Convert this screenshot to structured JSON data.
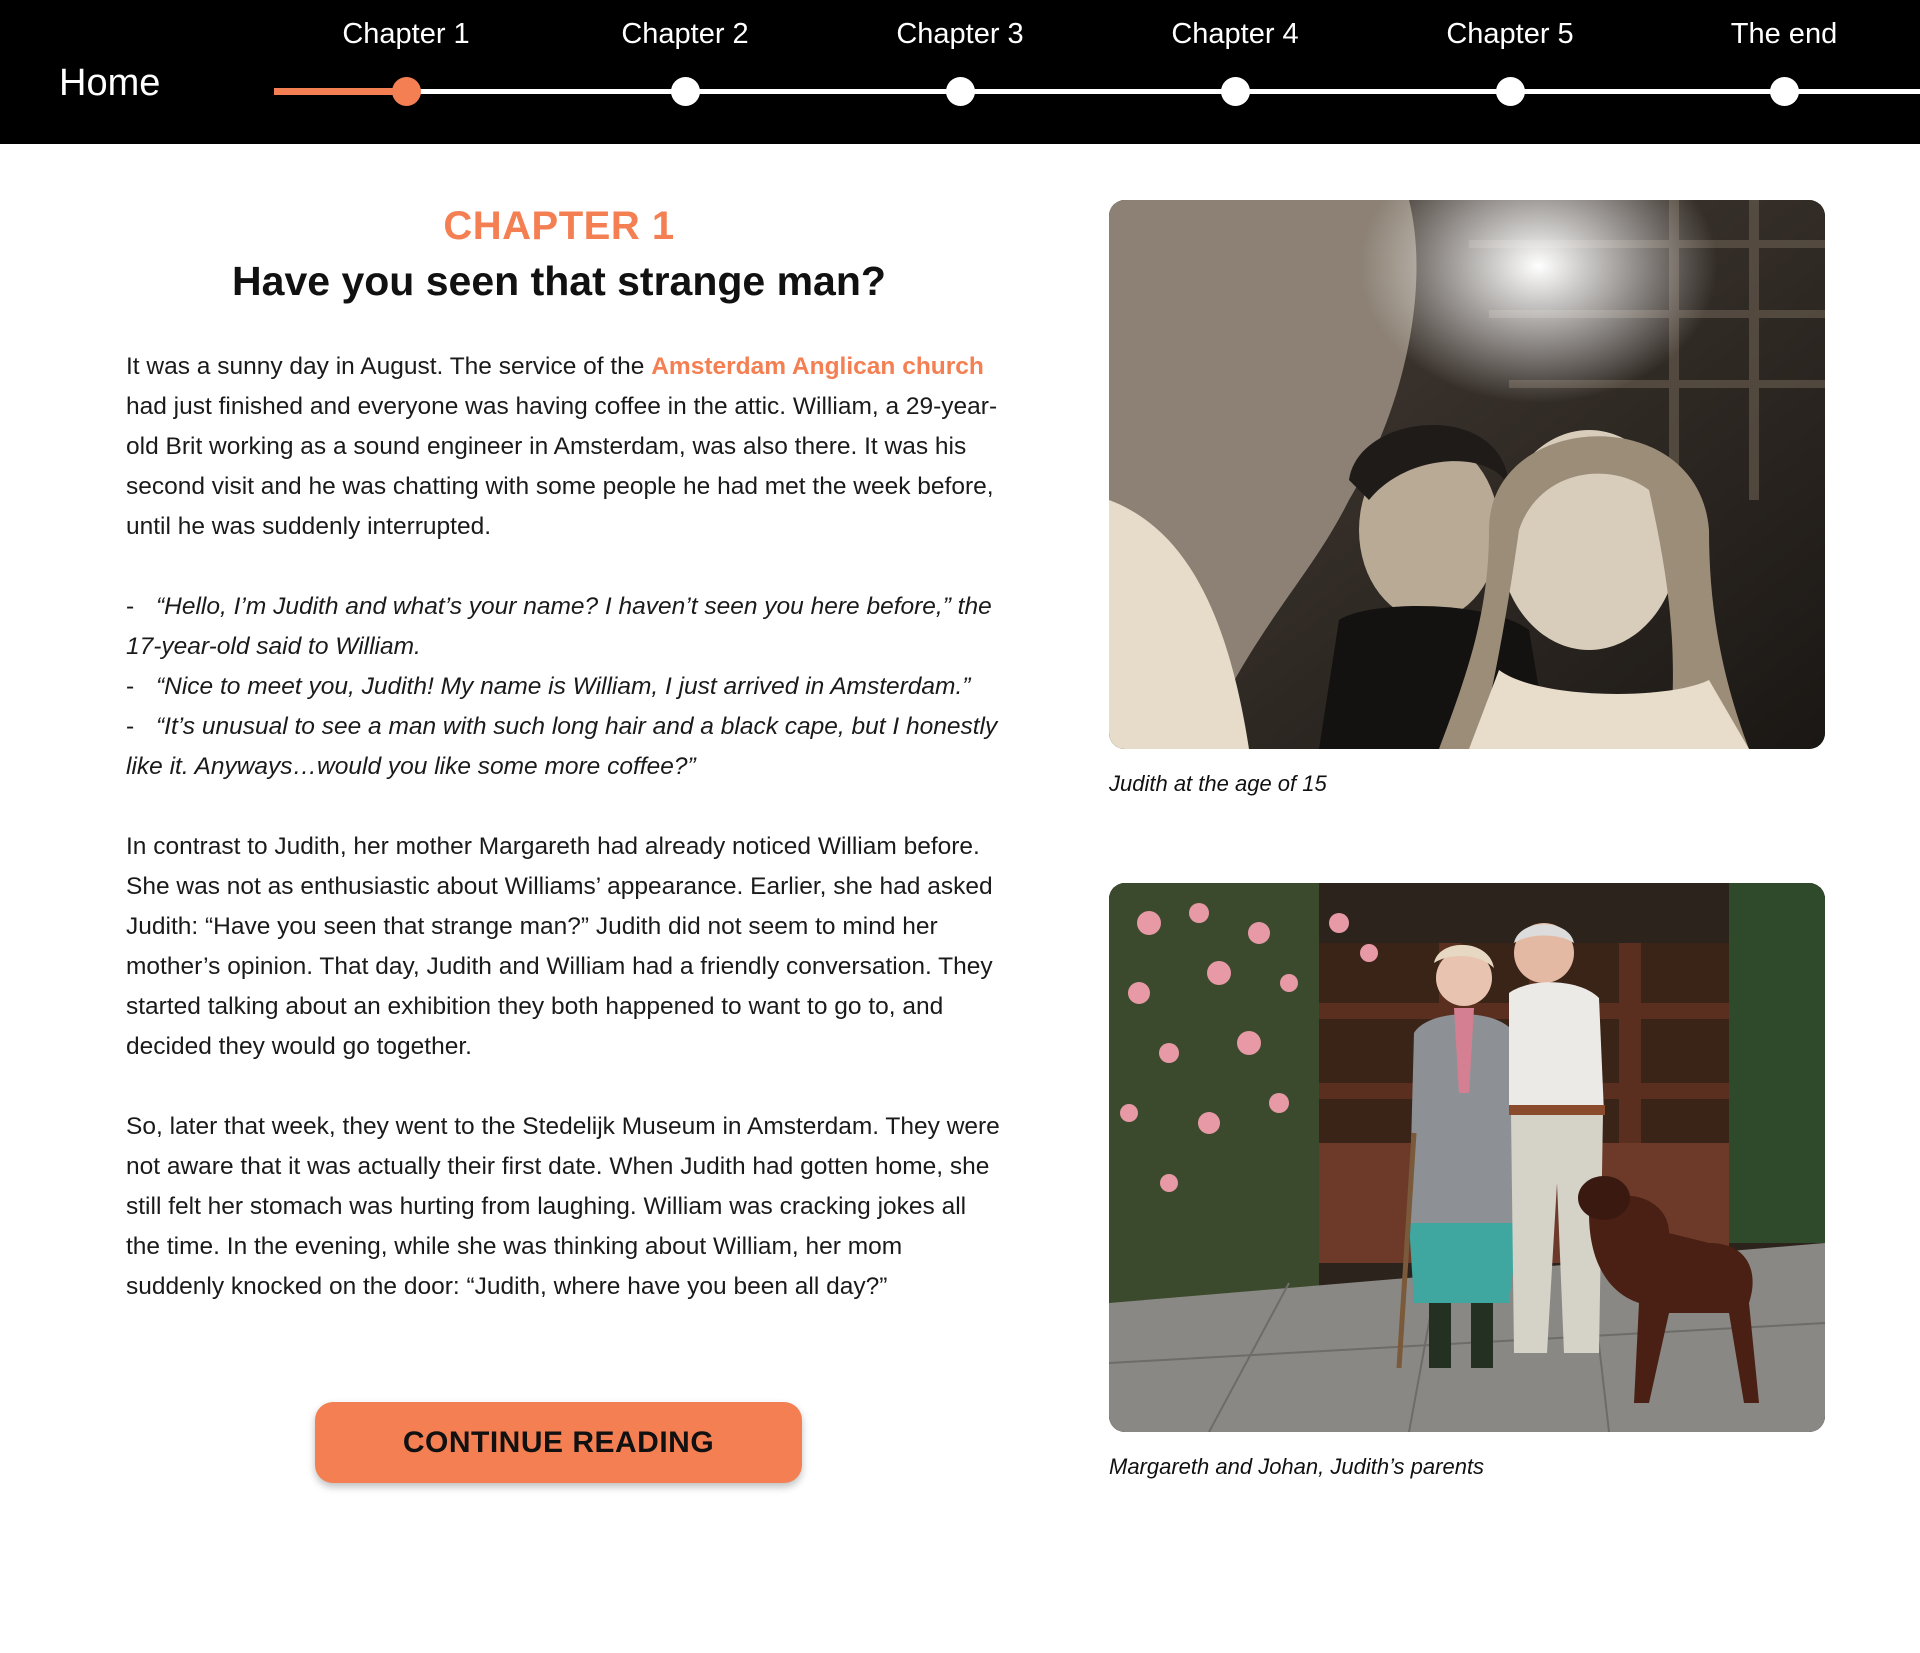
{
  "nav": {
    "home_label": "Home",
    "steps": [
      {
        "label": "Chapter 1",
        "active": true
      },
      {
        "label": "Chapter 2",
        "active": false
      },
      {
        "label": "Chapter 3",
        "active": false
      },
      {
        "label": "Chapter 4",
        "active": false
      },
      {
        "label": "Chapter 5",
        "active": false
      },
      {
        "label": "The end",
        "active": false
      }
    ],
    "accent_color": "#f37f52"
  },
  "chapter": {
    "number": "CHAPTER 1",
    "title": "Have you seen that strange man?"
  },
  "story": {
    "p1_before_link": "It was a sunny day in August. The service of the ",
    "p1_link": "Amsterdam Anglican church",
    "p1_after_link": " had just finished and everyone was having coffee in the attic. William, a 29-year-old Brit working as a sound engineer in Amsterdam, was also there. It was his second visit and he was chatting with some people he had met the week before, until he was suddenly interrupted.",
    "dialogue": [
      "“Hello, I’m Judith and what’s your name? I haven’t seen you here before,”  the 17-year-old said to William.",
      "“Nice to meet you, Judith! My name is William, I just arrived in Amsterdam.”",
      "“It’s unusual to see a man with such long hair and a black cape, but I honestly like it. Anyways…would you like some more coffee?”"
    ],
    "dialogue_marker": "-",
    "p2": "In contrast to Judith, her mother Margareth had already noticed William before. She was not as enthusiastic about Williams’ appearance. Earlier, she had asked Judith: “Have you seen that strange man?” Judith did not seem to mind her mother’s opinion. That day, Judith and William had a friendly conversation. They started talking about an exhibition they both happened to want to go to, and decided they would go together.",
    "p3": "So, later that week, they went to the Stedelijk Museum in Amsterdam. They were not aware that it was actually their first date. When Judith had gotten home, she still felt her stomach was hurting from laughing. William was cracking jokes all the time. In the evening, while she was thinking about William, her mom suddenly knocked on the door: “Judith, where have you been all day?”"
  },
  "continue_button": "CONTINUE READING",
  "photos": [
    {
      "caption": "Judith at the age of 15"
    },
    {
      "caption": "Margareth and Johan, Judith’s parents"
    }
  ]
}
